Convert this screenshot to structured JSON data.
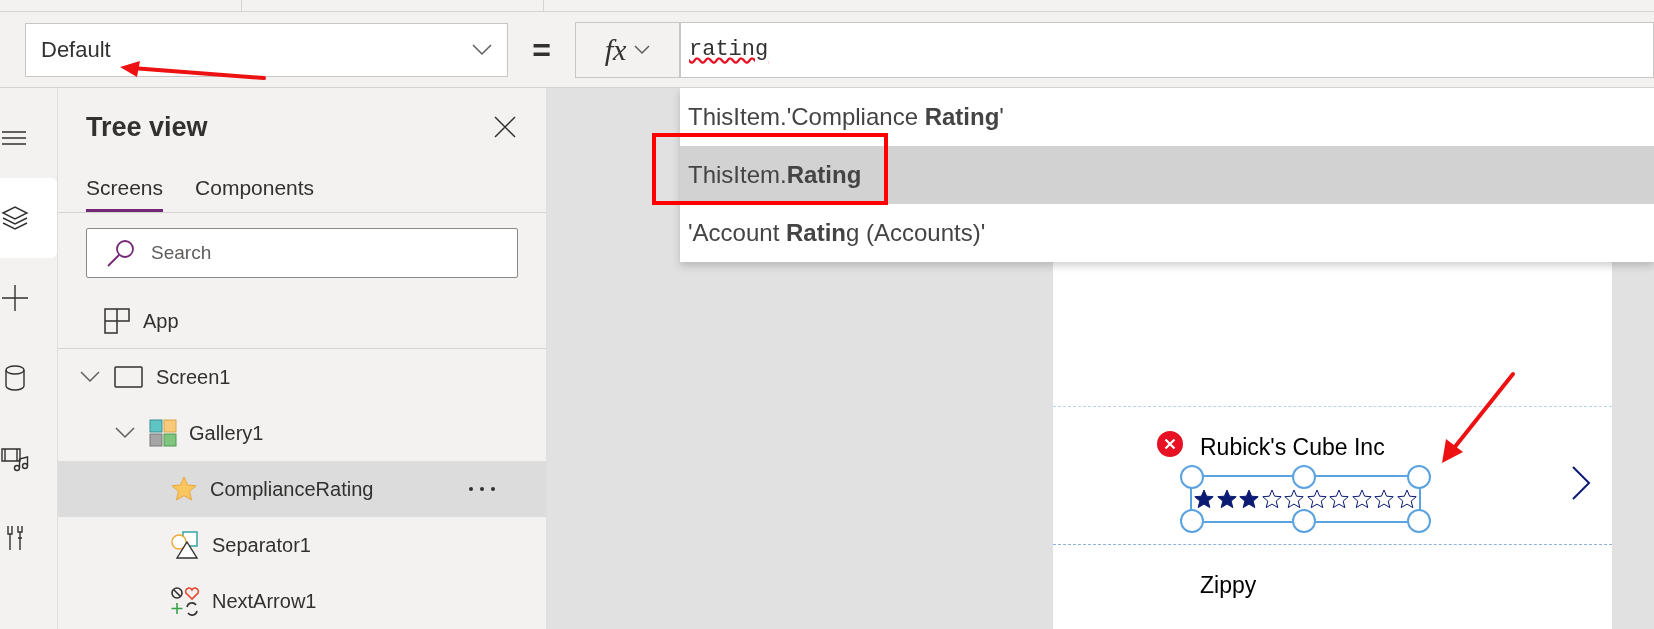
{
  "property_dropdown": {
    "value": "Default"
  },
  "formula_bar": {
    "equals": "=",
    "fx": "fx",
    "value": "rating",
    "misspelled": true
  },
  "suggestions": [
    {
      "text": "ThisItem.'Compliance **Rating**'",
      "selected": false,
      "outlined": false
    },
    {
      "text": "ThisItem.**Rating**",
      "selected": true,
      "outlined": true
    },
    {
      "text": "'Account **Ratin**g (Accounts)'",
      "selected": false,
      "outlined": false
    }
  ],
  "left_rail": [
    {
      "kind": "menu",
      "selected": false
    },
    {
      "kind": "layers",
      "selected": true
    },
    {
      "kind": "add",
      "selected": false
    },
    {
      "kind": "data",
      "selected": false
    },
    {
      "kind": "media",
      "selected": false
    },
    {
      "kind": "tools",
      "selected": false
    }
  ],
  "tree_view": {
    "title": "Tree view",
    "tabs": [
      {
        "label": "Screens",
        "selected": true
      },
      {
        "label": "Components",
        "selected": false
      }
    ],
    "search": {
      "placeholder": "Search"
    },
    "items": [
      {
        "label": "App",
        "kind": "app",
        "selected": false
      },
      {
        "label": "Screen1",
        "kind": "screen",
        "selected": false,
        "expanded": true,
        "children": [
          {
            "label": "Gallery1",
            "kind": "gallery",
            "selected": false,
            "expanded": true,
            "children": [
              {
                "label": "ComplianceRating",
                "kind": "rating",
                "selected": true
              },
              {
                "label": "Separator1",
                "kind": "shapes",
                "selected": false
              },
              {
                "label": "NextArrow1",
                "kind": "icons",
                "selected": false
              }
            ]
          }
        ]
      }
    ]
  },
  "gallery": {
    "items": [
      {
        "title": "Rubick's Cube Inc",
        "stars": 3,
        "selected": true,
        "error": true
      },
      {
        "title": "Zippy",
        "selected": false,
        "error": false
      }
    ]
  }
}
